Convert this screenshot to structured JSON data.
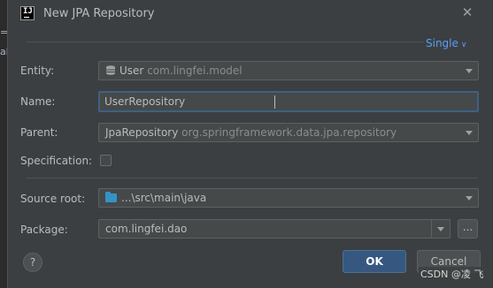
{
  "dialog": {
    "title": "New JPA Repository",
    "close_icon": "close-icon",
    "app_icon": "intellij-icon",
    "mode": "Single"
  },
  "backdrop_glyphs": [
    "=",
    "ab"
  ],
  "fields": {
    "entity": {
      "label": "Entity:",
      "value": "User",
      "sub": "com.lingfei.model",
      "icon": "database-icon"
    },
    "name": {
      "label": "Name:",
      "value": "UserRepository"
    },
    "parent": {
      "label": "Parent:",
      "value": "JpaRepository",
      "sub": "org.springframework.data.jpa.repository"
    },
    "specification": {
      "label": "Specification:",
      "checked": false
    },
    "source_root": {
      "label": "Source root:",
      "value": "...\\src\\main\\java",
      "icon": "folder-icon"
    },
    "package": {
      "label": "Package:",
      "value": "com.lingfei.dao",
      "browse": "..."
    }
  },
  "buttons": {
    "help": "?",
    "ok": "OK",
    "cancel": "Cancel"
  },
  "watermark": "CSDN @凌 飞",
  "colors": {
    "background": "#3c3f41",
    "accent_link": "#589df6",
    "primary_button": "#365880",
    "focus_border": "#3d6185"
  }
}
